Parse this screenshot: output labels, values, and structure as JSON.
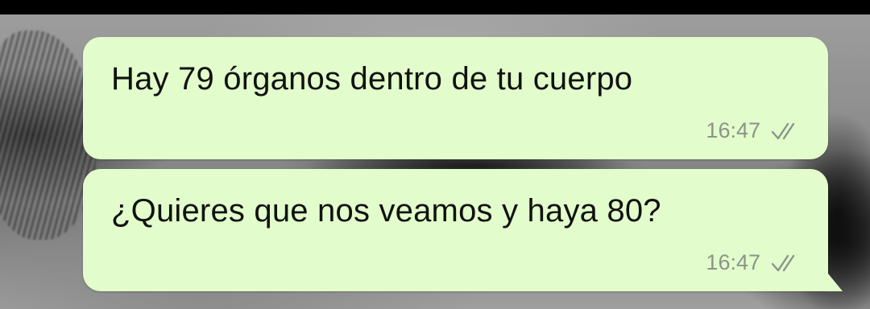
{
  "chat": {
    "messages": [
      {
        "text": "Hay 79 órganos dentro de tu cuerpo",
        "time": "16:47",
        "status_icon": "double-check-icon"
      },
      {
        "text": "¿Quieres que nos veamos y haya 80?",
        "time": "16:47",
        "status_icon": "double-check-icon"
      }
    ]
  },
  "colors": {
    "bubble": "#e2fdcb",
    "meta_text": "#8b948a",
    "top_bar": "#000000"
  }
}
